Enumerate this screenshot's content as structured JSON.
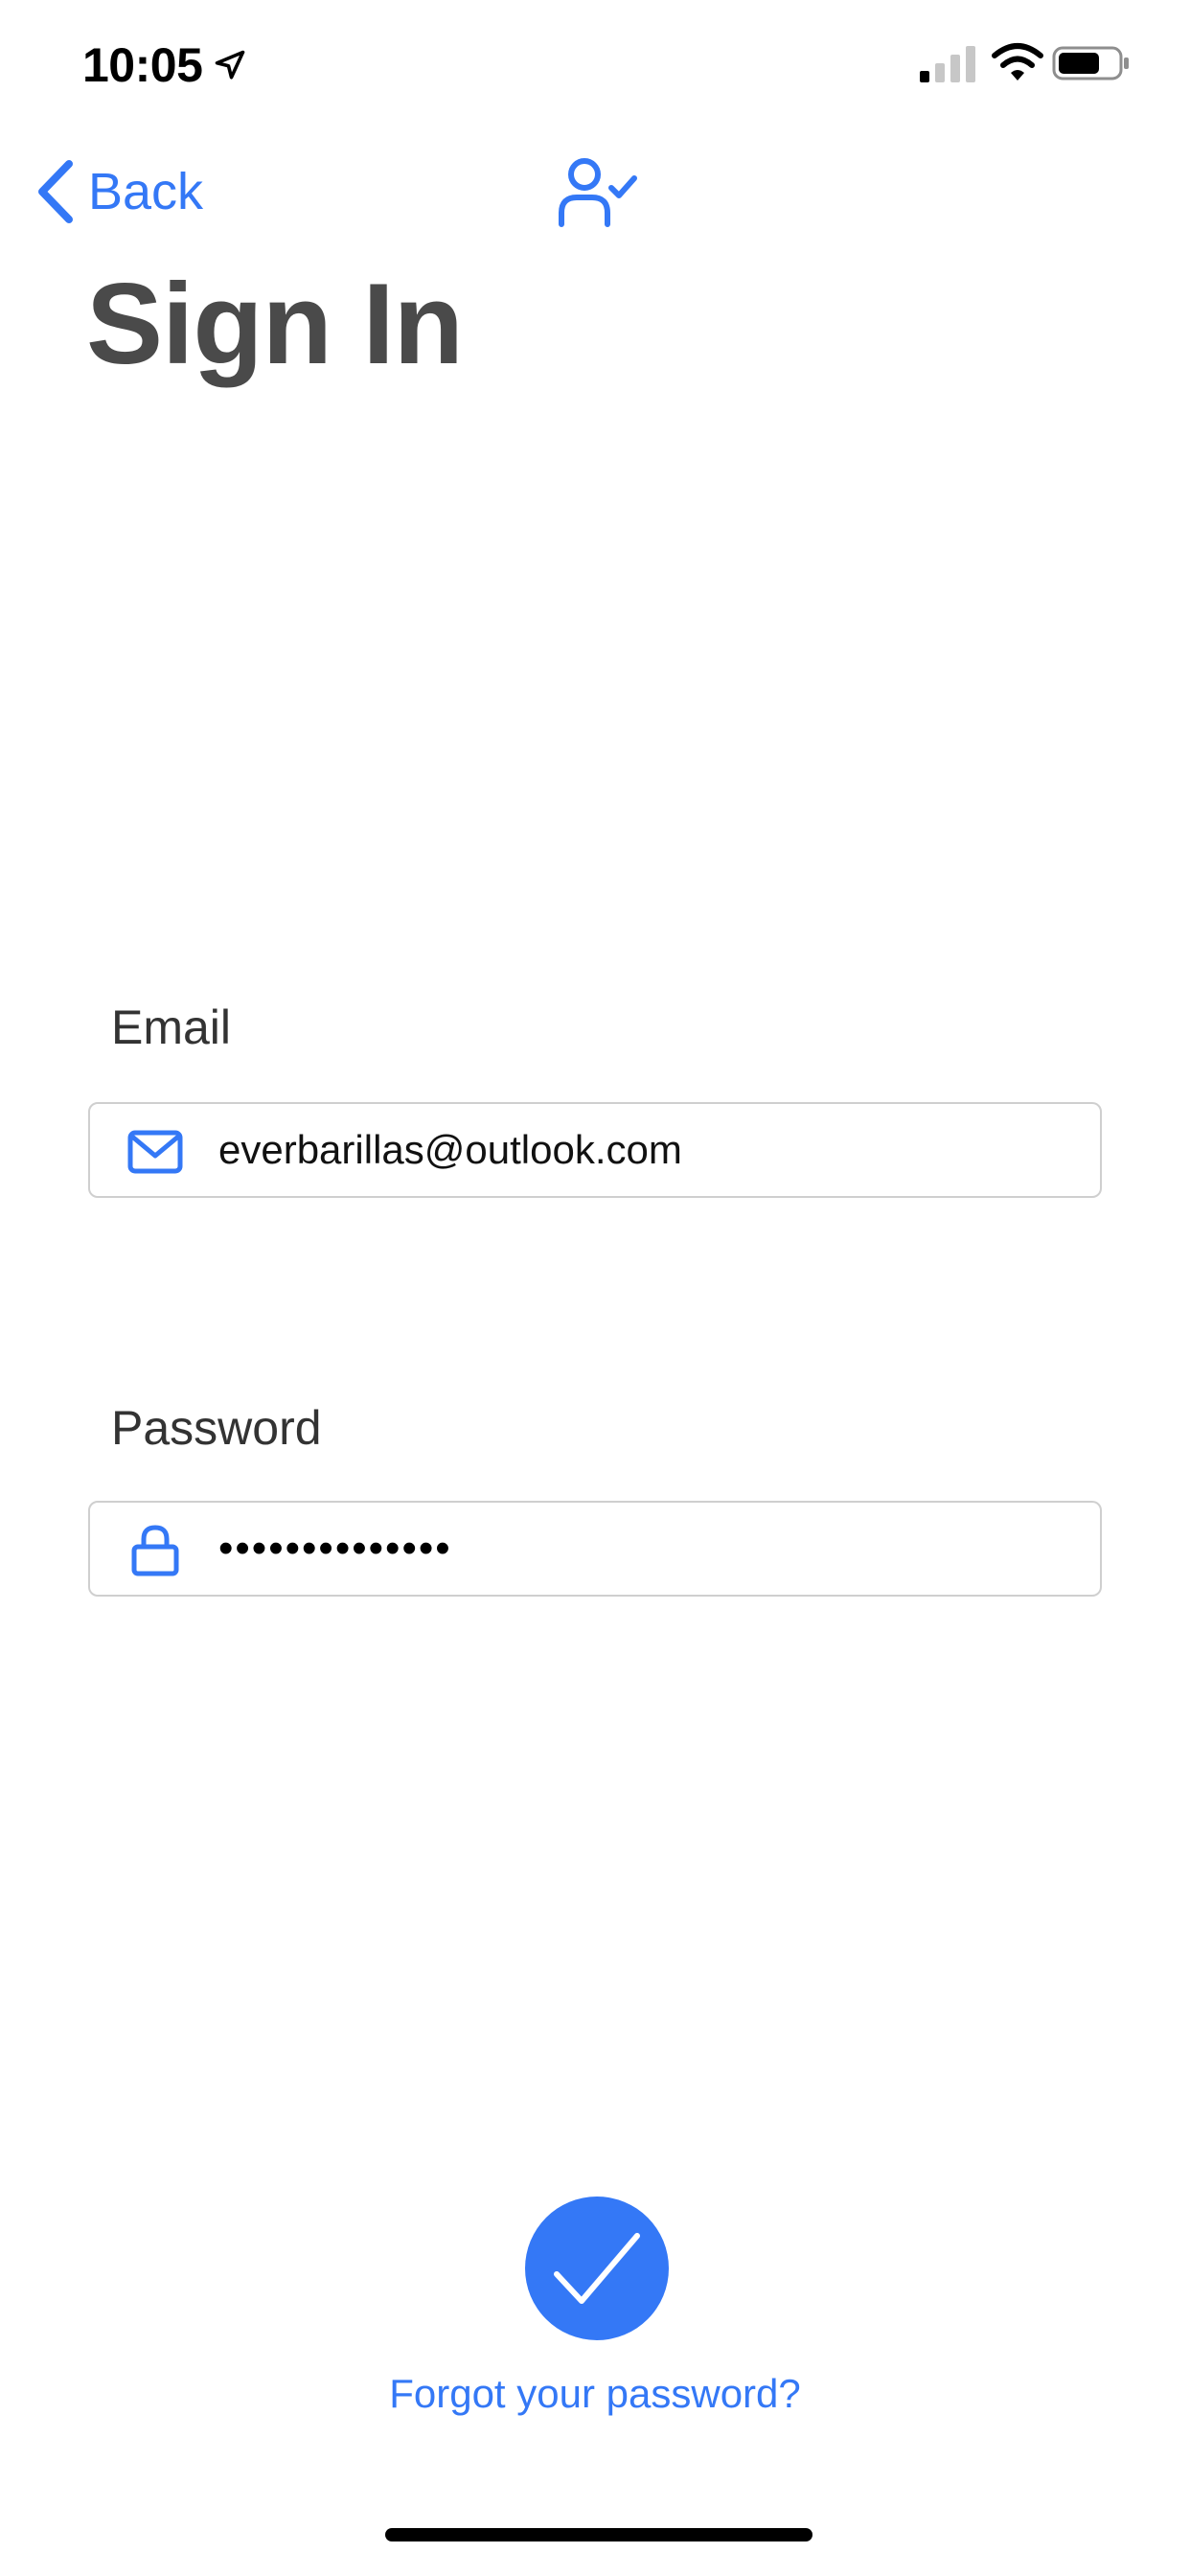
{
  "status_bar": {
    "time": "10:05",
    "icons": [
      "location-arrow-icon",
      "cellular-signal-icon",
      "wifi-icon",
      "battery-icon"
    ]
  },
  "nav": {
    "back_label": "Back",
    "back_icon": "chevron-left-icon",
    "center_icon": "user-check-icon"
  },
  "page": {
    "title": "Sign In"
  },
  "form": {
    "email": {
      "label": "Email",
      "value": "everbarillas@outlook.com",
      "icon": "envelope-icon"
    },
    "password": {
      "label": "Password",
      "masked_value": "••••••••••••••",
      "icon": "lock-icon"
    }
  },
  "actions": {
    "submit_icon": "checkmark-icon",
    "forgot_label": "Forgot your password?"
  },
  "colors": {
    "accent": "#3478f6",
    "title": "#4a4a4a",
    "border": "#cfcfcf"
  }
}
